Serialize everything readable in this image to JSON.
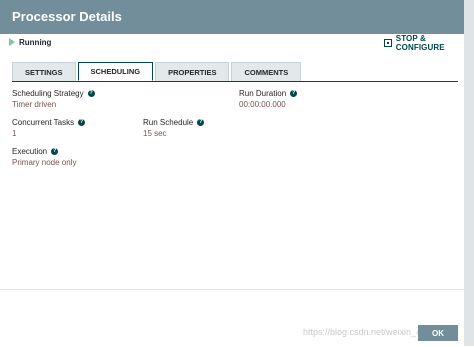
{
  "header": {
    "title": "Processor Details"
  },
  "status": {
    "label": "Running",
    "icon": "play-icon",
    "color": "#7dc7a0"
  },
  "toolbar": {
    "stop_configure_label": "STOP & CONFIGURE"
  },
  "tabs": [
    {
      "label": "SETTINGS",
      "active": false
    },
    {
      "label": "SCHEDULING",
      "active": true
    },
    {
      "label": "PROPERTIES",
      "active": false
    },
    {
      "label": "COMMENTS",
      "active": false
    }
  ],
  "scheduling": {
    "strategy_label": "Scheduling Strategy",
    "strategy_value": "Timer driven",
    "concurrent_label": "Concurrent Tasks",
    "concurrent_value": "1",
    "run_schedule_label": "Run Schedule",
    "run_schedule_value": "15 sec",
    "run_duration_label": "Run Duration",
    "run_duration_value": "00:00:00.000",
    "execution_label": "Execution",
    "execution_value": "Primary node only"
  },
  "footer": {
    "ok_label": "OK"
  },
  "watermark": "https://blog.csdn.net/weixin_41084687",
  "colors": {
    "header": "#728e9b",
    "accent": "#004849",
    "value_text": "#775351"
  }
}
